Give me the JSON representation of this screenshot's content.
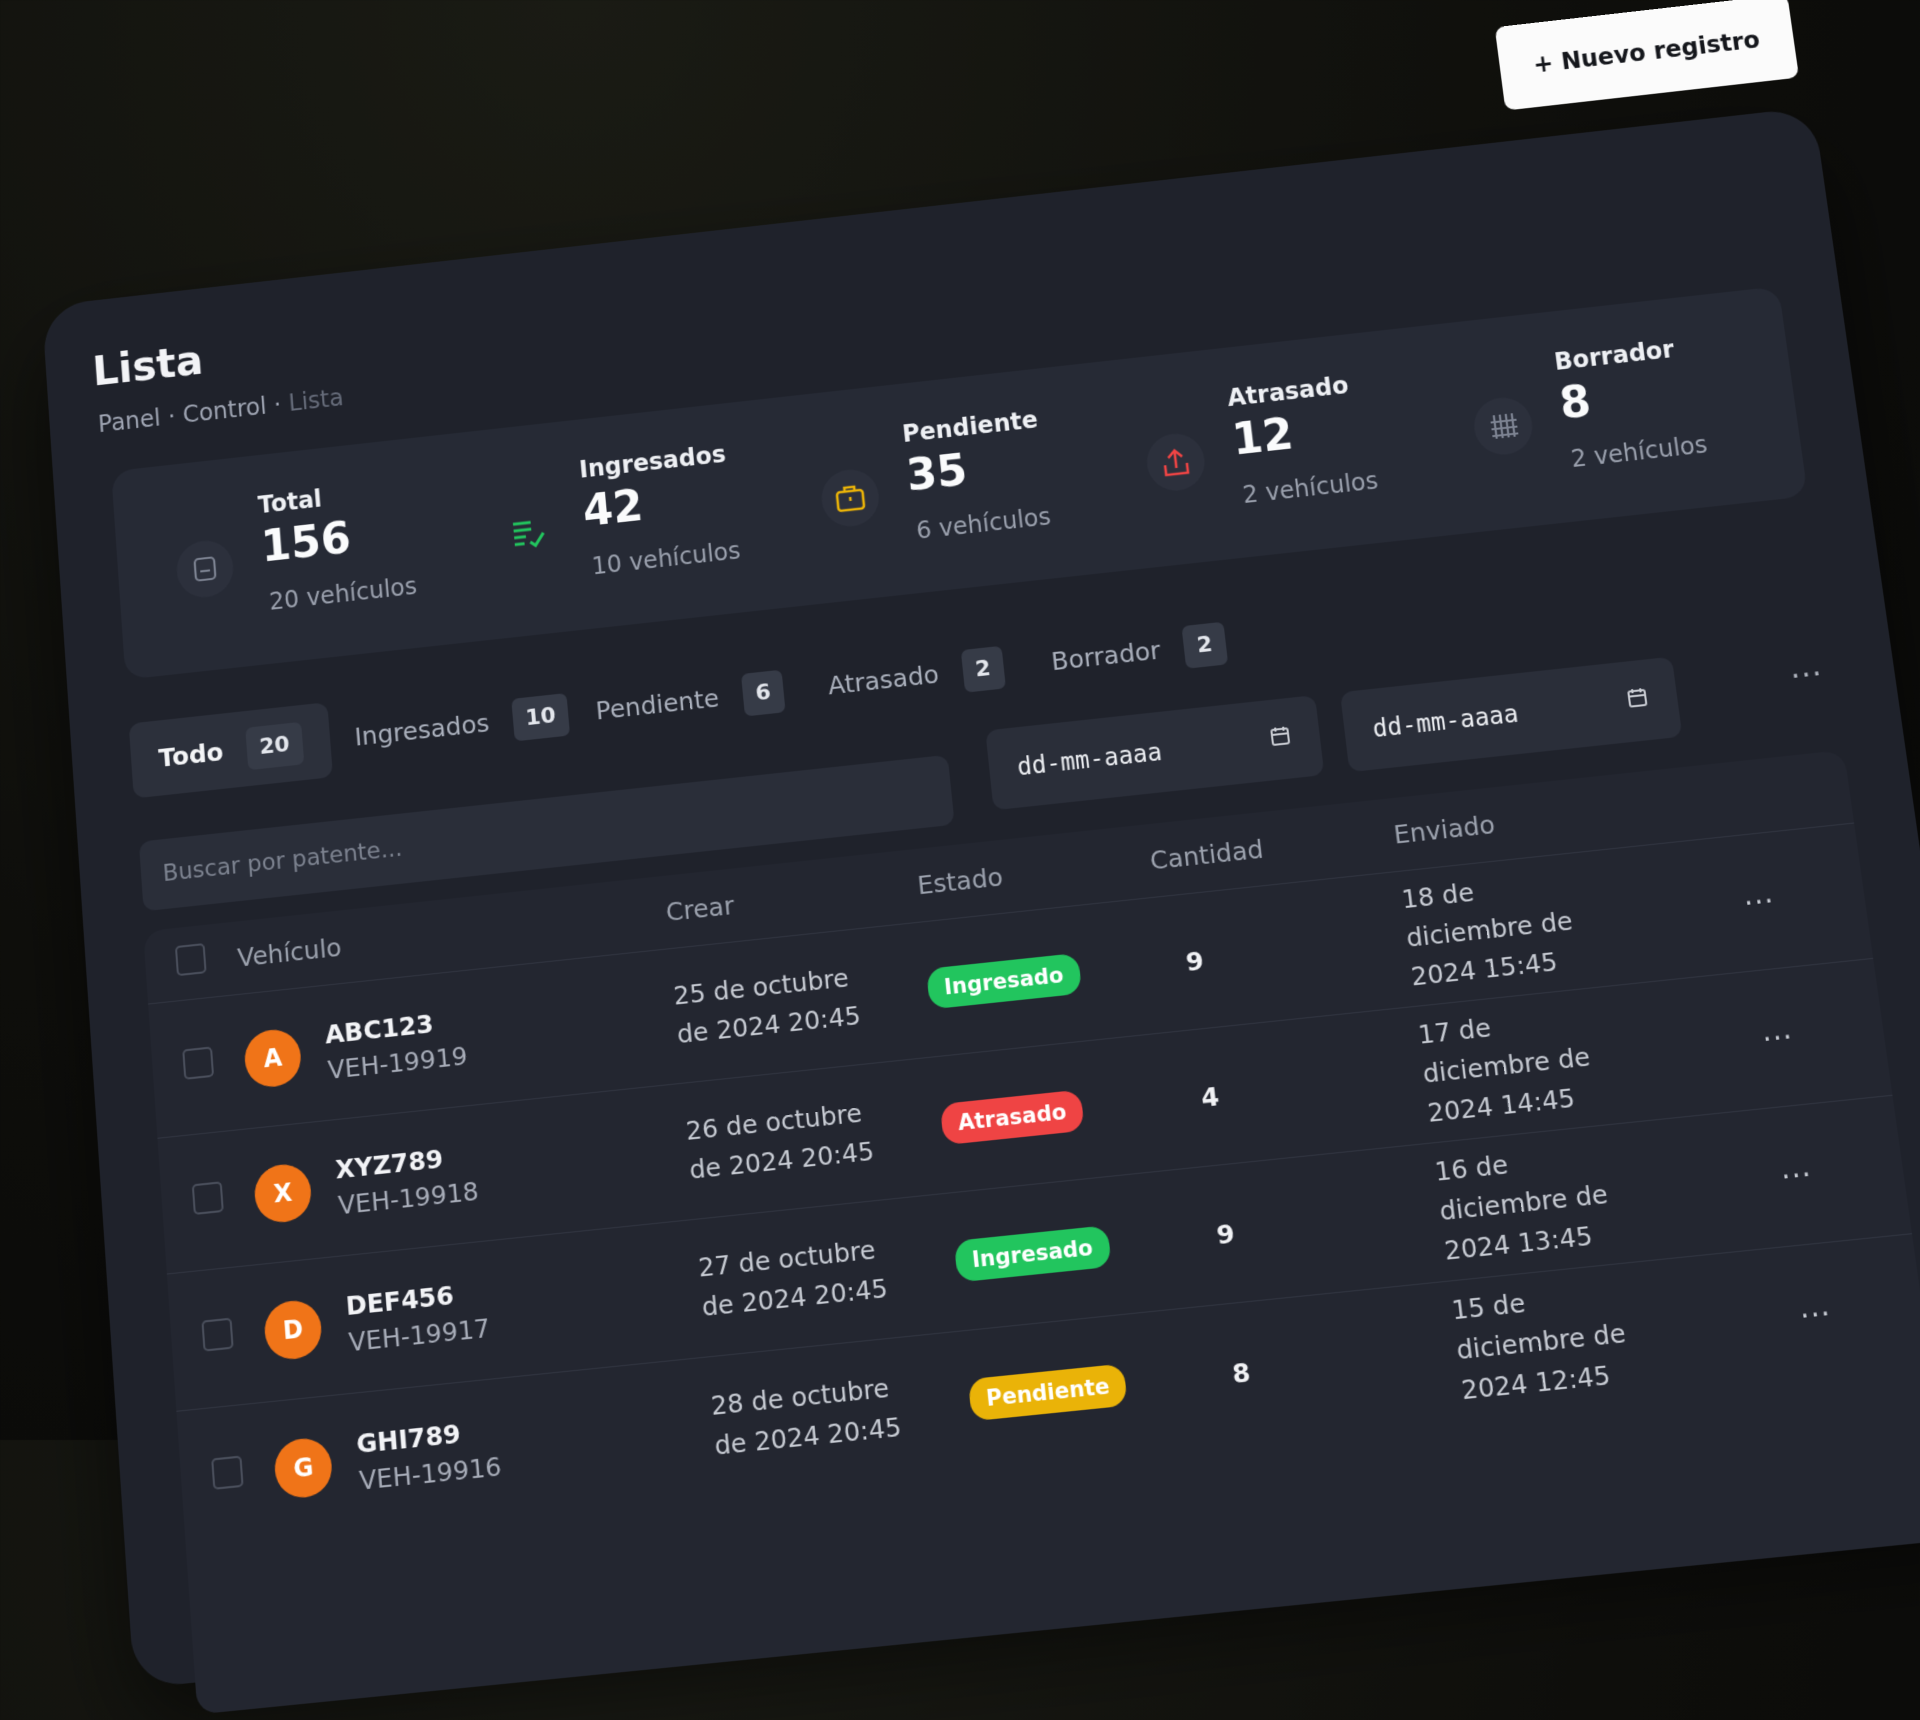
{
  "header": {
    "title": "Lista",
    "breadcrumb": [
      "Panel",
      "Control",
      "Lista"
    ],
    "new_button": "+ Nuevo registro"
  },
  "stats": [
    {
      "label": "Total",
      "value": "156",
      "sub": "20 vehículos",
      "icon": "document-icon",
      "color": "#7d8392"
    },
    {
      "label": "Ingresados",
      "value": "42",
      "sub": "10 vehículos",
      "icon": "list-check-icon",
      "color": "#22c55e"
    },
    {
      "label": "Pendiente",
      "value": "35",
      "sub": "6 vehículos",
      "icon": "briefcase-icon",
      "color": "#eab308"
    },
    {
      "label": "Atrasado",
      "value": "12",
      "sub": "2 vehículos",
      "icon": "upload-icon",
      "color": "#ef4444"
    },
    {
      "label": "Borrador",
      "value": "8",
      "sub": "2 vehículos",
      "icon": "grid-icon",
      "color": "#7d8392"
    }
  ],
  "tabs": [
    {
      "label": "Todo",
      "count": "20"
    },
    {
      "label": "Ingresados",
      "count": "10"
    },
    {
      "label": "Pendiente",
      "count": "6"
    },
    {
      "label": "Atrasado",
      "count": "2"
    },
    {
      "label": "Borrador",
      "count": "2"
    }
  ],
  "filters": {
    "date_from_placeholder": "dd-mm-aaaa",
    "date_to_placeholder": "dd-mm-aaaa",
    "more": "···"
  },
  "search": {
    "placeholder": "Buscar por patente..."
  },
  "table": {
    "columns": [
      "Vehículo",
      "Crear",
      "Estado",
      "Cantidad",
      "Enviado"
    ],
    "rows": [
      {
        "initial": "A",
        "plate": "ABC123",
        "id": "VEH-19919",
        "created": "25 de octubre de 2024 20:45",
        "status": "Ingresado",
        "status_color": "#22c55e",
        "qty": "9",
        "sent": "18 de diciembre de 2024 15:45",
        "more": "···"
      },
      {
        "initial": "X",
        "plate": "XYZ789",
        "id": "VEH-19918",
        "created": "26 de octubre de 2024 20:45",
        "status": "Atrasado",
        "status_color": "#ef4444",
        "qty": "4",
        "sent": "17 de diciembre de 2024 14:45",
        "more": "···"
      },
      {
        "initial": "D",
        "plate": "DEF456",
        "id": "VEH-19917",
        "created": "27 de octubre de 2024 20:45",
        "status": "Ingresado",
        "status_color": "#22c55e",
        "qty": "9",
        "sent": "16 de diciembre de 2024 13:45",
        "more": "···"
      },
      {
        "initial": "G",
        "plate": "GHI789",
        "id": "VEH-19916",
        "created": "28 de octubre de 2024 20:45",
        "status": "Pendiente",
        "status_color": "#eab308",
        "qty": "8",
        "sent": "15 de diciembre de 2024 12:45",
        "more": "···"
      }
    ]
  }
}
